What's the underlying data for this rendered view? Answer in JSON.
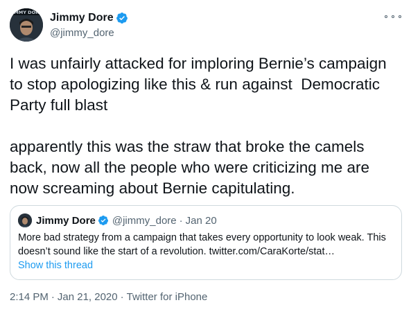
{
  "tweet": {
    "author": {
      "display_name": "Jimmy Dore",
      "handle": "@jimmy_dore",
      "verified": true,
      "avatar_banner_text": "JIMMY DORE"
    },
    "paragraphs": [
      "I was unfairly attacked for imploring Bernie’s campaign to stop apologizing like this & run against  Democratic Party full blast",
      "apparently this was the straw that broke the camels back, now all the people who were criticizing me are now screaming about Bernie capitulating."
    ],
    "quoted": {
      "display_name": "Jimmy Dore",
      "handle": "@jimmy_dore",
      "separator": "·",
      "date": "Jan 20",
      "text": "More bad strategy from a campaign that takes every opportunity to look weak. This doesn’t sound like the start of a revolution. twitter.com/CaraKorte/stat…",
      "show_thread": "Show this thread"
    },
    "meta": {
      "time": "2:14 PM",
      "separator": "·",
      "date": "Jan 21, 2020",
      "source": "Twitter for iPhone"
    }
  },
  "colors": {
    "text": "#0f1419",
    "secondary": "#536471",
    "link": "#1d9bf0",
    "verified": "#1d9bf0",
    "border": "#cfd9de"
  },
  "icons": {
    "verified": "verified-badge-icon",
    "more": "more-options-icon"
  }
}
